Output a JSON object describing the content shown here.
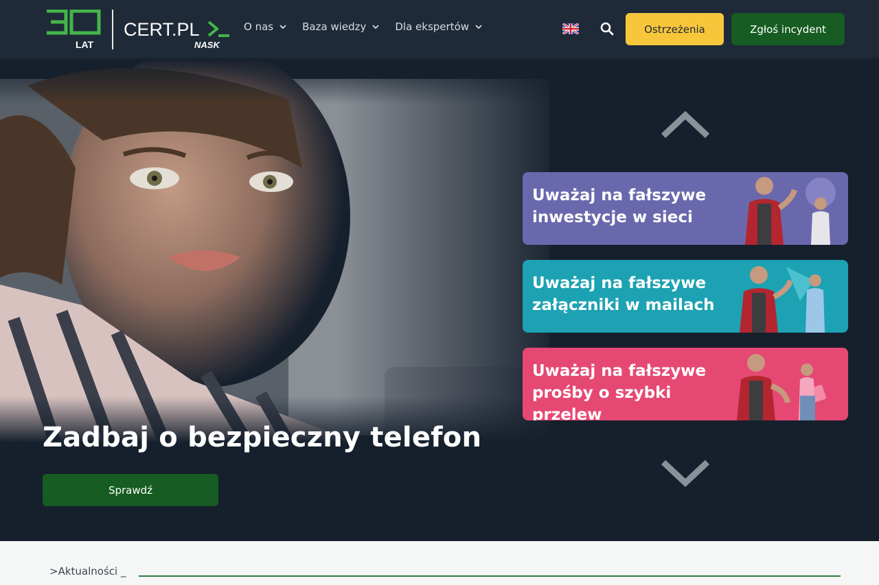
{
  "header": {
    "logo_years": "30",
    "logo_years_label": "LAT",
    "logo_name": "CERT.PL",
    "logo_sub": "NASK",
    "nav": [
      {
        "label": "O nas"
      },
      {
        "label": "Baza wiedzy"
      },
      {
        "label": "Dla ekspertów"
      }
    ],
    "language_icon": "uk-flag-icon",
    "search_icon": "search-icon",
    "warnings_label": "Ostrzeżenia",
    "report_label": "Zgłoś incydent"
  },
  "hero": {
    "title": "Zadbaj o bezpieczny telefon",
    "button_label": "Sprawdź",
    "cards": [
      {
        "text": "Uważaj na fałszywe inwestycje w sieci"
      },
      {
        "text": "Uważaj na fałszywe załączniki w mailach"
      },
      {
        "text": "Uważaj na fałszywe prośby o szybki przelew"
      }
    ]
  },
  "news": {
    "label": ">Aktualności _"
  },
  "colors": {
    "header_bg": "#1f2a38",
    "hero_bg": "#16202d",
    "brand_green": "#175c22",
    "logo_green": "#4caf50",
    "warning_yellow": "#f8c63b",
    "card_purple": "#6a68ad",
    "card_teal": "#1ca2b3",
    "card_pink": "#e64874"
  }
}
